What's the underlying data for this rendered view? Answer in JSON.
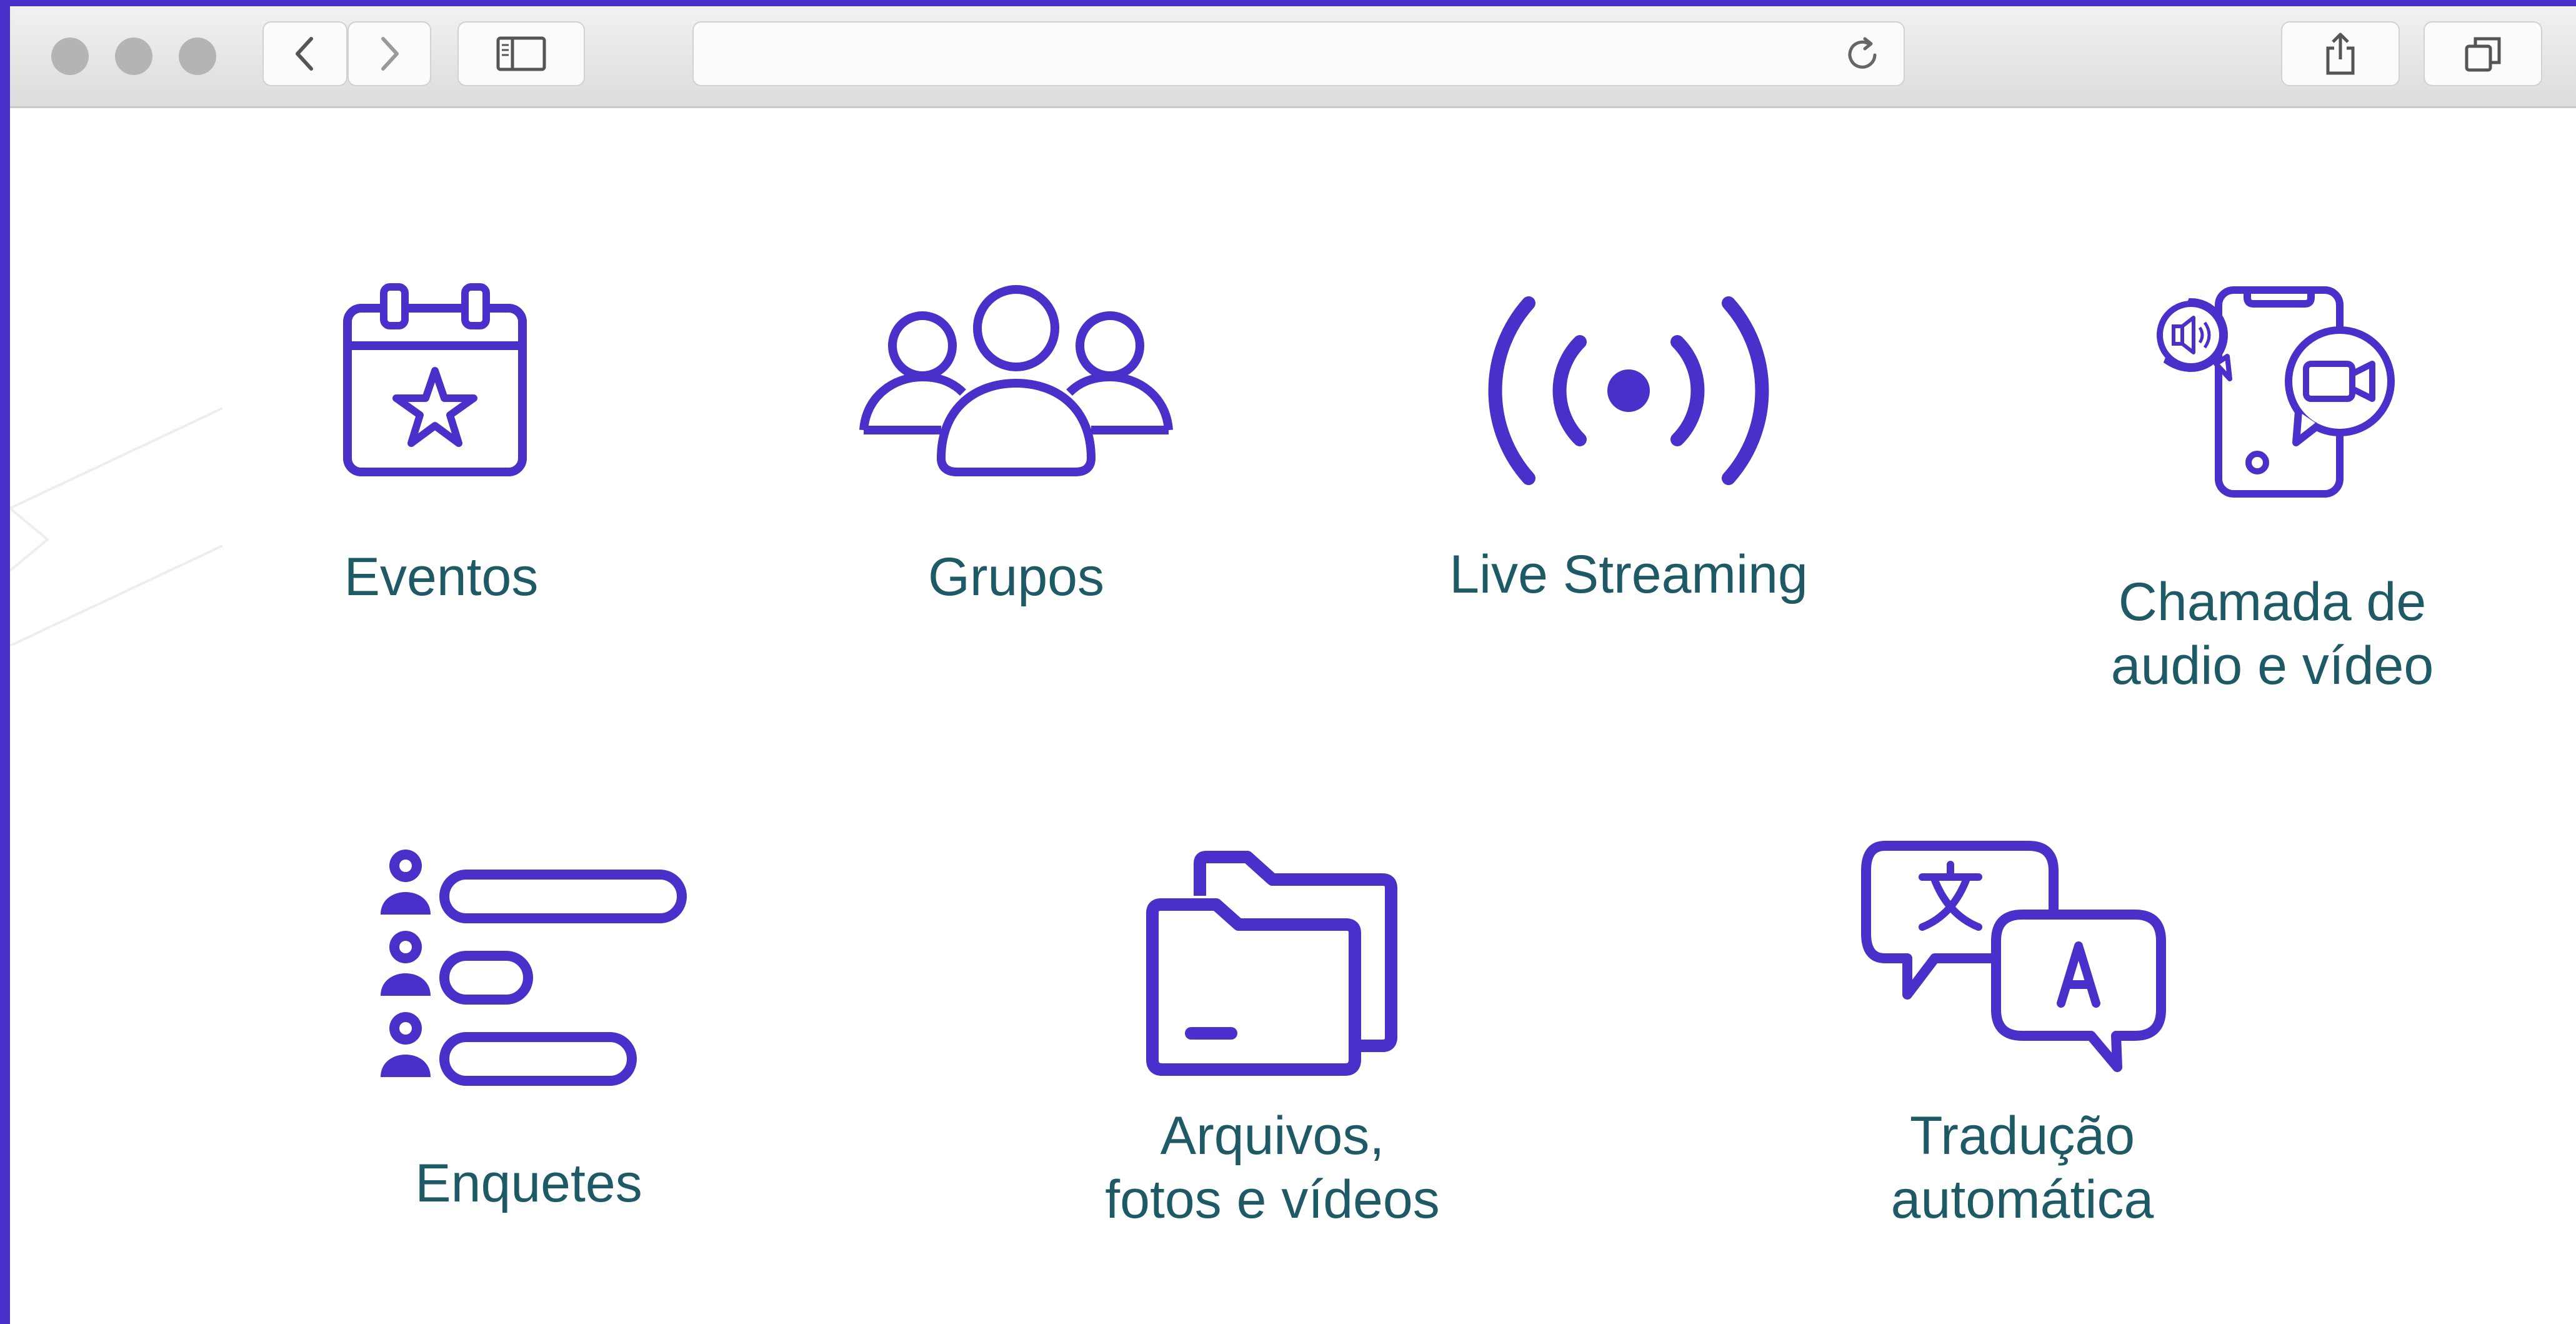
{
  "browser": {
    "address_value": ""
  },
  "colors": {
    "icon": "#4a2fcb",
    "label": "#1e5a66",
    "frame": "#4a2fcb"
  },
  "features": [
    {
      "label": "Eventos",
      "icon": "calendar-star-icon"
    },
    {
      "label": "Grupos",
      "icon": "group-users-icon"
    },
    {
      "label": "Live Streaming",
      "icon": "broadcast-icon"
    },
    {
      "label_line1": "Chamada de",
      "label_line2": "audio e vídeo",
      "icon": "phone-audio-video-call-icon"
    },
    {
      "label": "Enquetes",
      "icon": "poll-list-icon"
    },
    {
      "label_line1": "Arquivos,",
      "label_line2": "fotos e vídeos",
      "icon": "folders-icon"
    },
    {
      "label_line1": "Tradução",
      "label_line2": "automática",
      "icon": "translate-chat-icon"
    }
  ]
}
